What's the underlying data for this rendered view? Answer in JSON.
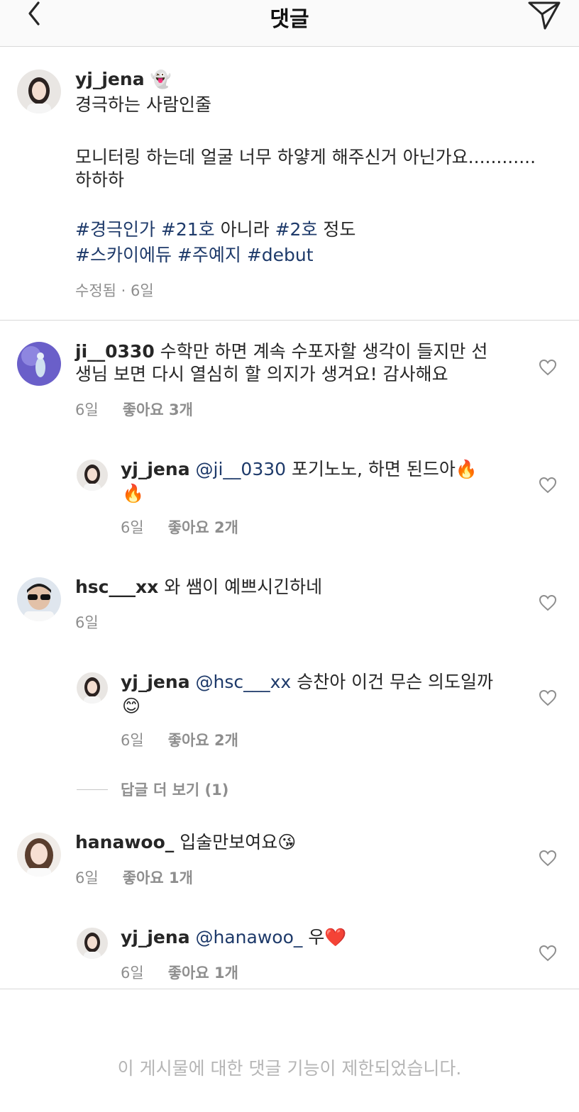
{
  "header": {
    "title": "댓글"
  },
  "caption": {
    "username": "yj_jena",
    "emoji": "👻",
    "line1": "경극하는 사람인줄",
    "line2": "모니터링 하는데 얼굴 너무 하얗게 해주신거 아닌가요............",
    "line3": "하하하",
    "tag1": "#경극인가",
    "tag2": "#21호",
    "text_mid": "아니라",
    "tag3": "#2호",
    "text_end": "정도",
    "tag4": "#스카이에듀",
    "tag5": "#주예지",
    "tag6": "#debut",
    "meta": "수정됨 · 6일"
  },
  "comments": [
    {
      "username": "ji__0330",
      "text_line1": "수학만 하면 계속 수포자할 생각이 들지만 선",
      "text_line2": "생님 보면 다시 열심히 할 의지가 생겨요! 감사해요",
      "time": "6일",
      "likes": "좋아요 3개"
    },
    {
      "username": "yj_jena",
      "mention": "@ji__0330",
      "text": "포기노노, 하면 된드아🔥",
      "text_line2": "🔥",
      "time": "6일",
      "likes": "좋아요 2개"
    },
    {
      "username": "hsc___xx",
      "text": "와 쌤이 예쁘시긴하네",
      "time": "6일"
    },
    {
      "username": "yj_jena",
      "mention": "@hsc___xx",
      "text": "승찬아 이건 무슨 의도일까",
      "text_line2": "😊",
      "time": "6일",
      "likes": "좋아요 2개"
    },
    {
      "username": "hanawoo_",
      "text": "입술만보여요😘",
      "time": "6일",
      "likes": "좋아요 1개"
    },
    {
      "username": "yj_jena",
      "mention": "@hanawoo_",
      "text": "우❤️",
      "time": "6일",
      "likes": "좋아요 1개"
    }
  ],
  "view_replies": "답글 더 보기 (1)",
  "footer": {
    "notice": "이 게시물에 대한 댓글 기능이 제한되었습니다."
  },
  "colors": {
    "link": "#1e3a6a",
    "muted": "#8e8e8e",
    "divider": "#d9d9d9"
  }
}
